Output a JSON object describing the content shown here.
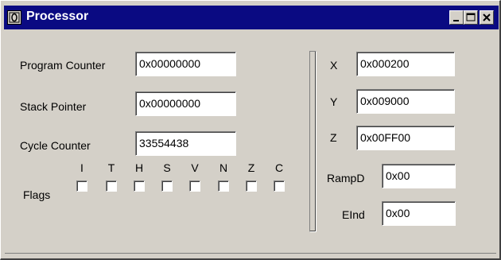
{
  "window": {
    "title": "Processor",
    "icon": "processor-app-icon",
    "controls": [
      "minimize-icon",
      "maximize-icon",
      "close-icon"
    ]
  },
  "registers": {
    "program_counter": {
      "label": "Program Counter",
      "value": "0x00000000"
    },
    "stack_pointer": {
      "label": "Stack Pointer",
      "value": "0x00000000"
    },
    "cycle_counter": {
      "label": "Cycle Counter",
      "value": "33554438"
    }
  },
  "flags": {
    "label": "Flags",
    "names": [
      "I",
      "T",
      "H",
      "S",
      "V",
      "N",
      "Z",
      "C"
    ],
    "checked": [
      false,
      false,
      false,
      false,
      false,
      false,
      false,
      false
    ]
  },
  "index_registers": {
    "x": {
      "label": "X",
      "value": "0x000200"
    },
    "y": {
      "label": "Y",
      "value": "0x009000"
    },
    "z": {
      "label": "Z",
      "value": "0x00FF00"
    },
    "rampd": {
      "label": "RampD",
      "value": "0x00"
    },
    "eind": {
      "label": "EInd",
      "value": "0x00"
    }
  }
}
